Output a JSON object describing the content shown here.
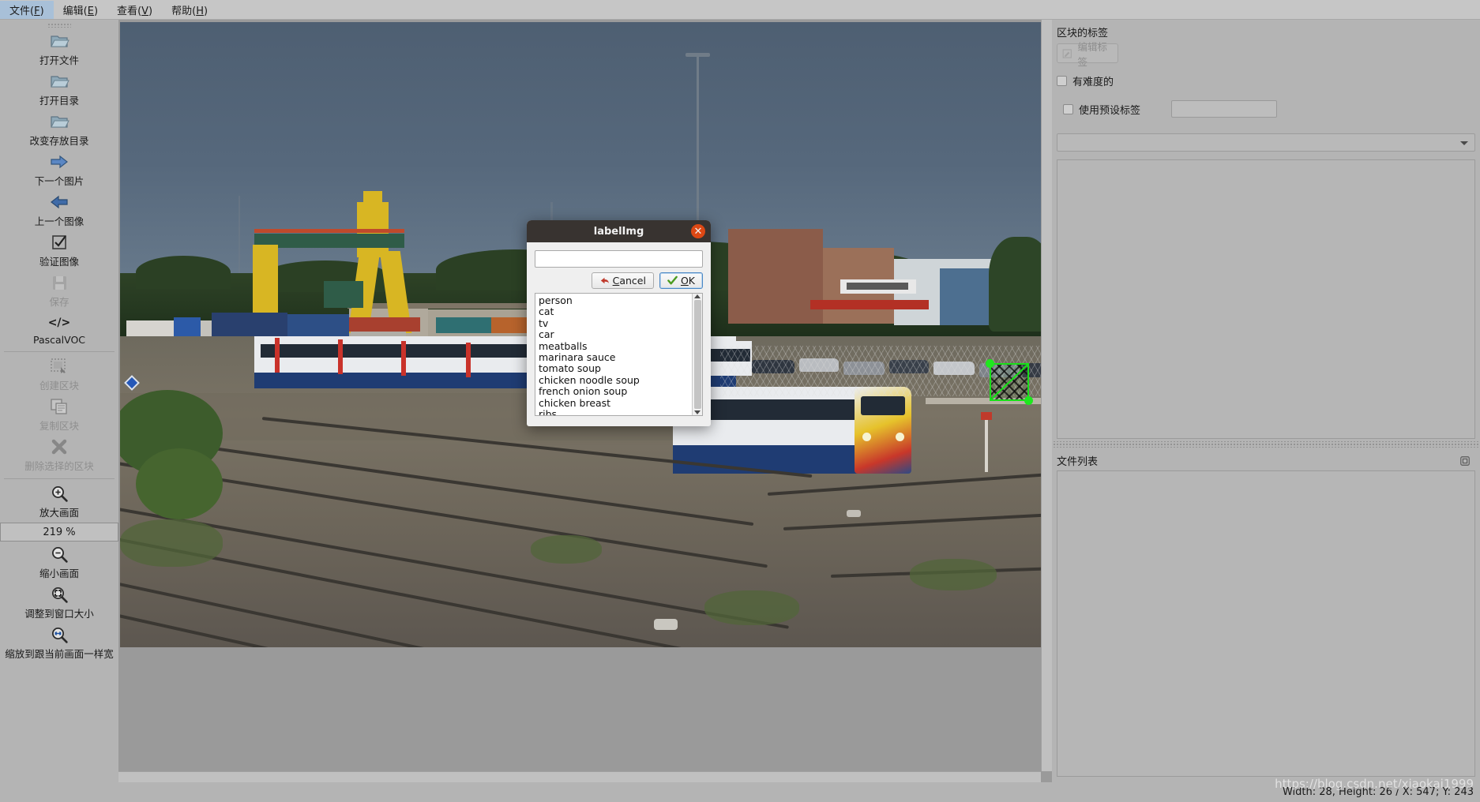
{
  "menubar": {
    "items": [
      {
        "label": "文件",
        "mnemonic": "F"
      },
      {
        "label": "编辑",
        "mnemonic": "E"
      },
      {
        "label": "查看",
        "mnemonic": "V"
      },
      {
        "label": "帮助",
        "mnemonic": "H"
      }
    ]
  },
  "toolbar": {
    "items": [
      {
        "label": "打开文件",
        "icon": "open-file-icon",
        "enabled": true
      },
      {
        "label": "打开目录",
        "icon": "open-dir-icon",
        "enabled": true
      },
      {
        "label": "改变存放目录",
        "icon": "change-save-dir-icon",
        "enabled": true
      },
      {
        "label": "下一个图片",
        "icon": "next-image-icon",
        "enabled": true
      },
      {
        "label": "上一个图像",
        "icon": "prev-image-icon",
        "enabled": true
      },
      {
        "label": "验证图像",
        "icon": "verify-image-icon",
        "enabled": true
      },
      {
        "label": "保存",
        "icon": "save-icon",
        "enabled": false
      },
      {
        "label": "PascalVOC",
        "icon": "format-code-icon",
        "enabled": true
      }
    ],
    "shape_items": [
      {
        "label": "创建区块",
        "icon": "create-rectbox-icon",
        "enabled": false
      },
      {
        "label": "复制区块",
        "icon": "duplicate-rectbox-icon",
        "enabled": false
      },
      {
        "label": "删除选择的区块",
        "icon": "delete-rectbox-icon",
        "enabled": false
      }
    ],
    "zoom_in": {
      "label": "放大画面",
      "icon": "zoom-in-icon"
    },
    "zoom_value": "219 %",
    "zoom_items": [
      {
        "label": "缩小画面",
        "icon": "zoom-out-icon"
      },
      {
        "label": "调整到窗口大小",
        "icon": "fit-window-icon"
      },
      {
        "label": "缩放到跟当前画面一样宽",
        "icon": "fit-width-icon"
      }
    ]
  },
  "right_panel": {
    "box_labels_title": "区块的标签",
    "edit_label_button": "编辑标签",
    "difficult_checkbox": "有难度的",
    "use_default_label_checkbox": "使用预设标签",
    "default_label_value": "",
    "combo_value": "",
    "file_list_title": "文件列表"
  },
  "dialog": {
    "title": "labelImg",
    "input_value": "",
    "cancel_label": "Cancel",
    "cancel_mnemonic": "C",
    "ok_label": "OK",
    "ok_mnemonic": "O",
    "close_glyph": "✕",
    "list_items": [
      "person",
      "cat",
      "tv",
      "car",
      "meatballs",
      "marinara sauce",
      "tomato soup",
      "chicken noodle soup",
      "french onion soup",
      "chicken breast",
      "ribs"
    ]
  },
  "statusbar": {
    "text": "Width: 28, Height: 26 / X: 547; Y: 243",
    "watermark": "https://blog.csdn.net/xiaokai1999"
  },
  "colors": {
    "accent_orange": "#dd4814",
    "bbox_green": "#18e018",
    "window_bg": "#b4b4b4",
    "dialog_titlebar": "#383330"
  }
}
